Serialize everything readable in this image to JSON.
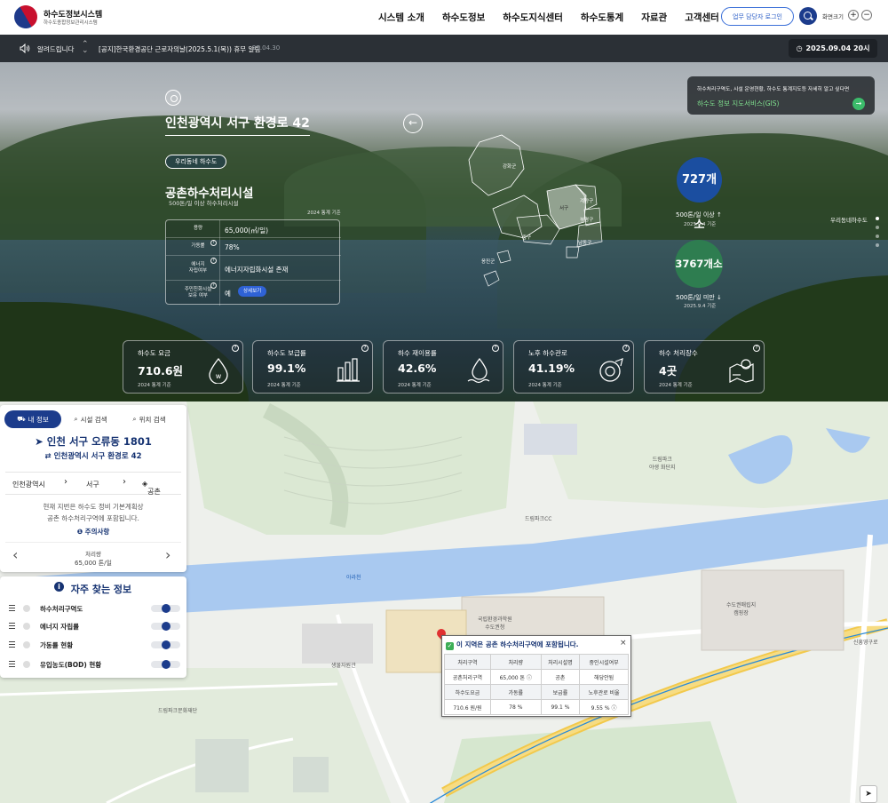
{
  "header": {
    "site_title": "하수도정보시스템",
    "site_subtitle": "하수도종합정보관리시스템",
    "nav": [
      "시스템 소개",
      "하수도정보",
      "하수도지식센터",
      "하수도통계",
      "자료관",
      "고객센터"
    ],
    "login_label": "업무 담당자 로그인",
    "zoom_label": "화면크기",
    "zoom_in": "+",
    "zoom_out": "−"
  },
  "notice": {
    "label": "알려드립니다",
    "text": "[공지]한국환경공단 근로자의날(2025.5.1(목)) 휴무 알림",
    "date": "25.04.30",
    "clock": "2025.09.04 20시"
  },
  "hero": {
    "address": "인천광역시 서구 환경로 42",
    "badge": "우리동네 하수도",
    "facility_name": "공촌하수처리시설",
    "facility_sub": "500톤/일 이상 하수처리시설",
    "stat_ref": "2024 통계 기준",
    "rows": [
      {
        "key": "용량",
        "value": "65,000(㎥/일)"
      },
      {
        "key": "가동률",
        "value": "78%"
      },
      {
        "key": "에너지\n자립여부",
        "value": "에너지자립화시설 존재"
      },
      {
        "key": "주민친화시설\n보유 여부",
        "value": "예"
      }
    ],
    "detail_label": "상세보기",
    "gis_desc": "하수처리구역도, 시설 운영현황, 하수도 통계지도등 자세히 알고 싶다면",
    "gis_link": "하수도 정보 지도서비스(GIS)",
    "districts": [
      "강화군",
      "서구",
      "계양구",
      "부평구",
      "중구",
      "남동구",
      "옹진군"
    ],
    "big_count": "727개소",
    "big_label": "500톤/일 이상",
    "big_date": "2025.9.4 기준",
    "small_count": "3767개소",
    "small_label": "500톤/일 미만",
    "small_date": "2025.9.4 기준",
    "side_nav": "우리동네하수도",
    "stats": [
      {
        "title": "하수도 요금",
        "value": "710.6원",
        "ref": "2024 통계 기준",
        "icon": "water-drop-coin-icon"
      },
      {
        "title": "하수도 보급률",
        "value": "99.1%",
        "ref": "2024 통계 기준",
        "icon": "bar-chart-icon"
      },
      {
        "title": "하수 재이용률",
        "value": "42.6%",
        "ref": "2024 통계 기준",
        "icon": "water-wave-icon"
      },
      {
        "title": "노후 하수관로",
        "value": "41.19%",
        "ref": "2024 통계 기준",
        "icon": "old-pipe-icon"
      },
      {
        "title": "하수 처리장수",
        "value": "4곳",
        "ref": "2024 통계 기준",
        "icon": "map-pin-icon"
      }
    ]
  },
  "panel": {
    "tabs": [
      "내 정보",
      "시설 검색",
      "위치 검색"
    ],
    "address": "인천 서구 오류동 1801",
    "road_address": "인천광역시 서구 환경로 42",
    "breadcrumb": [
      "인천광역시",
      "서구",
      "공촌"
    ],
    "desc_line1": "현재 지번은 하수도 정비 기본계획상",
    "desc_line2": "공촌 하수처리구역에 포함됩니다.",
    "note": "주의사항",
    "slide_title": "처리량",
    "slide_value": "65,000 톤/일"
  },
  "faq": {
    "title": "자주 찾는 정보",
    "items": [
      "하수처리구역도",
      "에너지 자립률",
      "가동률 현황",
      "유입농도(BOD) 현황"
    ]
  },
  "map_labels": {
    "dreampark_village": "드림파크\n야생 화단지",
    "dreampark_cc": "드림파크CC",
    "arabeon": "아라천",
    "ecology": "생물자원관",
    "dreampark_culture": "드림파크문화재단",
    "research": "국립환경과학원\n수도권청",
    "sudo_park": "수도권매립지\n캠핑장",
    "sinheung": "신흥영구로"
  },
  "popup": {
    "title": "이 지역은 공촌 하수처리구역에 포함됩니다.",
    "close": "×",
    "header1": [
      "처리구역",
      "처리량",
      "처리시설명",
      "중인시설여부"
    ],
    "row1": [
      "공촌처리구역",
      "65,000 톤",
      "공촌",
      "해당안됨"
    ],
    "header2": [
      "하수도요금",
      "가동률",
      "보급률",
      "노후관로 비율"
    ],
    "row2": [
      "710.6 원/원",
      "78 %",
      "99.1 %",
      "9.55 %"
    ]
  }
}
